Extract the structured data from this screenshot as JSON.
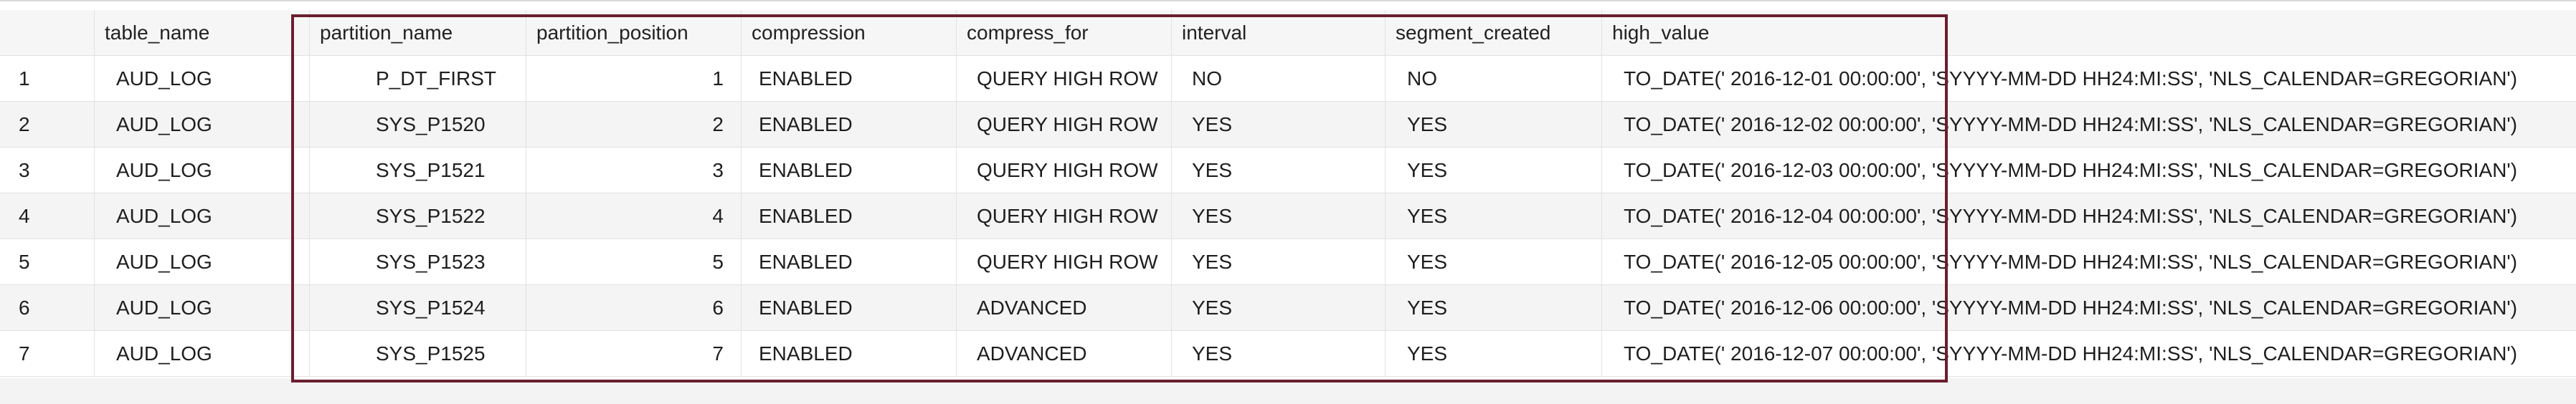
{
  "table": {
    "columns": [
      "",
      "table_name",
      "partition_name",
      "partition_position",
      "compression",
      "compress_for",
      "interval",
      "segment_created",
      "high_value"
    ],
    "rows": [
      {
        "idx": "1",
        "table_name": "AUD_LOG",
        "partition_name": "P_DT_FIRST",
        "partition_position": "1",
        "compression": "ENABLED",
        "compress_for": "QUERY HIGH ROW",
        "interval": "NO",
        "segment_created": "NO",
        "high_value": "TO_DATE(' 2016-12-01 00:00:00', 'SYYYY-MM-DD HH24:MI:SS', 'NLS_CALENDAR=GREGORIAN')"
      },
      {
        "idx": "2",
        "table_name": "AUD_LOG",
        "partition_name": "SYS_P1520",
        "partition_position": "2",
        "compression": "ENABLED",
        "compress_for": "QUERY HIGH ROW",
        "interval": "YES",
        "segment_created": "YES",
        "high_value": "TO_DATE(' 2016-12-02 00:00:00', 'SYYYY-MM-DD HH24:MI:SS', 'NLS_CALENDAR=GREGORIAN')"
      },
      {
        "idx": "3",
        "table_name": "AUD_LOG",
        "partition_name": "SYS_P1521",
        "partition_position": "3",
        "compression": "ENABLED",
        "compress_for": "QUERY HIGH ROW",
        "interval": "YES",
        "segment_created": "YES",
        "high_value": "TO_DATE(' 2016-12-03 00:00:00', 'SYYYY-MM-DD HH24:MI:SS', 'NLS_CALENDAR=GREGORIAN')"
      },
      {
        "idx": "4",
        "table_name": "AUD_LOG",
        "partition_name": "SYS_P1522",
        "partition_position": "4",
        "compression": "ENABLED",
        "compress_for": "QUERY HIGH ROW",
        "interval": "YES",
        "segment_created": "YES",
        "high_value": "TO_DATE(' 2016-12-04 00:00:00', 'SYYYY-MM-DD HH24:MI:SS', 'NLS_CALENDAR=GREGORIAN')"
      },
      {
        "idx": "5",
        "table_name": "AUD_LOG",
        "partition_name": "SYS_P1523",
        "partition_position": "5",
        "compression": "ENABLED",
        "compress_for": "QUERY HIGH ROW",
        "interval": "YES",
        "segment_created": "YES",
        "high_value": "TO_DATE(' 2016-12-05 00:00:00', 'SYYYY-MM-DD HH24:MI:SS', 'NLS_CALENDAR=GREGORIAN')"
      },
      {
        "idx": "6",
        "table_name": "AUD_LOG",
        "partition_name": "SYS_P1524",
        "partition_position": "6",
        "compression": "ENABLED",
        "compress_for": "ADVANCED",
        "interval": "YES",
        "segment_created": "YES",
        "high_value": "TO_DATE(' 2016-12-06 00:00:00', 'SYYYY-MM-DD HH24:MI:SS', 'NLS_CALENDAR=GREGORIAN')"
      },
      {
        "idx": "7",
        "table_name": "AUD_LOG",
        "partition_name": "SYS_P1525",
        "partition_position": "7",
        "compression": "ENABLED",
        "compress_for": "ADVANCED",
        "interval": "YES",
        "segment_created": "YES",
        "high_value": "TO_DATE(' 2016-12-07 00:00:00', 'SYYYY-MM-DD HH24:MI:SS', 'NLS_CALENDAR=GREGORIAN')"
      }
    ]
  },
  "colors": {
    "highlight_border": "#6b1f2e",
    "row_alt": "#f4f4f4",
    "grid_line": "#e2e2e2"
  }
}
